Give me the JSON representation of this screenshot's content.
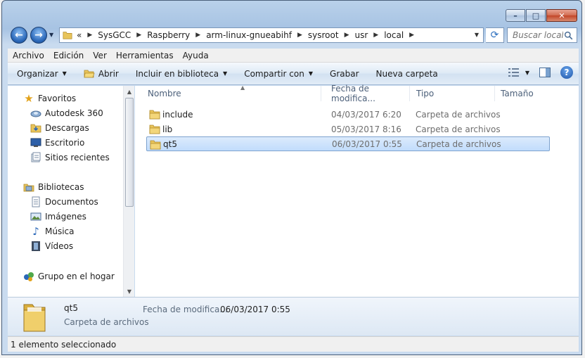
{
  "window": {
    "minimize": "–",
    "maximize": "□",
    "close": "✕"
  },
  "address": {
    "prefix": "«",
    "crumbs": [
      "SysGCC",
      "Raspberry",
      "arm-linux-gnueabihf",
      "sysroot",
      "usr",
      "local"
    ],
    "search_placeholder": "Buscar local"
  },
  "menu": [
    "Archivo",
    "Edición",
    "Ver",
    "Herramientas",
    "Ayuda"
  ],
  "commands": {
    "organize": "Organizar",
    "open": "Abrir",
    "include_library": "Incluir en biblioteca",
    "share": "Compartir con",
    "burn": "Grabar",
    "new_folder": "Nueva carpeta"
  },
  "nav": {
    "favorites": "Favoritos",
    "favorites_items": [
      "Autodesk 360",
      "Descargas",
      "Escritorio",
      "Sitios recientes"
    ],
    "libraries": "Bibliotecas",
    "libraries_items": [
      "Documentos",
      "Imágenes",
      "Música",
      "Vídeos"
    ],
    "homegroup": "Grupo en el hogar"
  },
  "columns": {
    "name": "Nombre",
    "date": "Fecha de modifica...",
    "type": "Tipo",
    "size": "Tamaño"
  },
  "files": [
    {
      "name": "include",
      "date": "04/03/2017 6:20",
      "type": "Carpeta de archivos"
    },
    {
      "name": "lib",
      "date": "05/03/2017 8:16",
      "type": "Carpeta de archivos"
    },
    {
      "name": "qt5",
      "date": "06/03/2017 0:55",
      "type": "Carpeta de archivos"
    }
  ],
  "details": {
    "name": "qt5",
    "type": "Carpeta de archivos",
    "date_label": "Fecha de modifica...",
    "date_value": "06/03/2017 0:55"
  },
  "status": "1 elemento seleccionado",
  "colors": {
    "accent": "#2a67b8",
    "selection": "#c1dcfc",
    "folder": "#e8c45a"
  }
}
